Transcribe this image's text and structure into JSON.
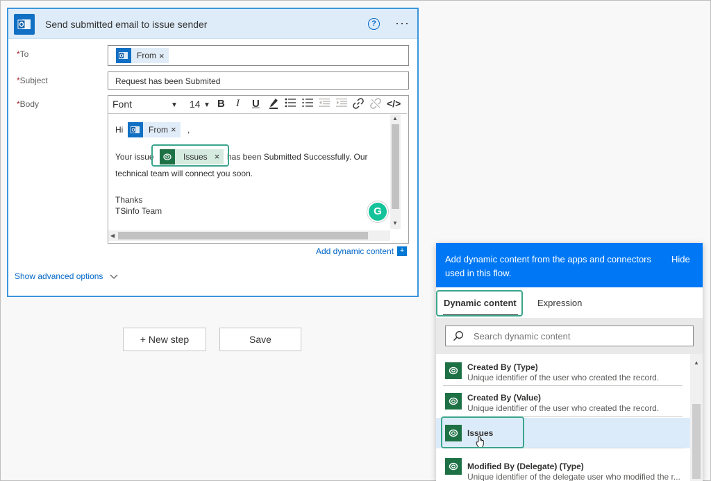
{
  "card": {
    "title": "Send submitted email to issue sender",
    "help_glyph": "?",
    "more_glyph": "···",
    "to_label": "To",
    "to_token": {
      "label": "From",
      "remove": "×"
    },
    "subject_label": "Subject",
    "subject_value": "Request has been Submited",
    "body_label": "Body",
    "required_mark": "*",
    "toolbar": {
      "font": "Font",
      "font_size": "14",
      "bold": "B",
      "italic": "I",
      "underline": "U",
      "code": "</>"
    },
    "body": {
      "line1_prefix": "Hi",
      "line1_token": {
        "label": "From",
        "remove": "×"
      },
      "line1_suffix": ",",
      "line2_prefix": "Your issue",
      "line2_token": {
        "label": "Issues",
        "remove": "×"
      },
      "line2_suffix": "has been Submitted Successfully. Our",
      "line3": "technical team will connect you soon.",
      "line4": "Thanks",
      "line5": "TSinfo Team"
    },
    "grammarly": "G",
    "add_dynamic": "Add dynamic content",
    "add_dynamic_plus": "+",
    "advanced": "Show advanced options"
  },
  "steps": {
    "new_step": "+ New step",
    "save": "Save"
  },
  "panel": {
    "description": "Add dynamic content from the apps and connectors used in this flow.",
    "hide": "Hide",
    "tabs": [
      "Dynamic content",
      "Expression"
    ],
    "search_placeholder": "Search dynamic content",
    "items": [
      {
        "name": "Created By (Type)",
        "desc": "Unique identifier of the user who created the record."
      },
      {
        "name": "Created By (Value)",
        "desc": "Unique identifier of the user who created the record."
      },
      {
        "name": "Issues",
        "desc": ""
      },
      {
        "name": "Modified By (Delegate) (Type)",
        "desc": "Unique identifier of the delegate user who modified the r..."
      }
    ]
  },
  "colors": {
    "accent": "#0078f5",
    "outlook": "#1170c4",
    "dataverse": "#1e7145",
    "highlight": "#3aa58c"
  }
}
